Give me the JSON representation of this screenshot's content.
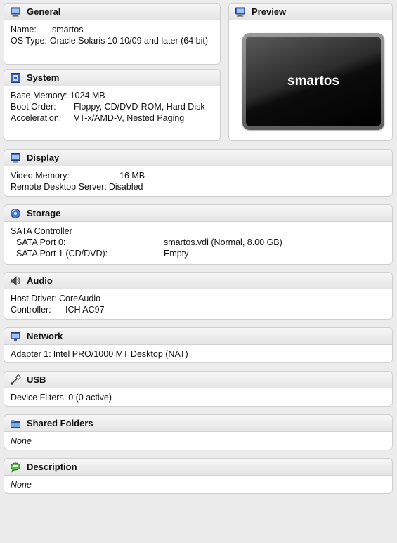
{
  "general": {
    "title": "General",
    "name_label": "Name:",
    "name_value": "smartos",
    "os_label": "OS Type:",
    "os_value": "Oracle Solaris 10 10/09 and later (64 bit)"
  },
  "preview": {
    "title": "Preview",
    "screen_text": "smartos"
  },
  "system": {
    "title": "System",
    "memory_label": "Base Memory:",
    "memory_value": "1024 MB",
    "boot_label": "Boot Order:",
    "boot_value": "Floppy, CD/DVD-ROM, Hard Disk",
    "accel_label": "Acceleration:",
    "accel_value": "VT-x/AMD-V, Nested Paging"
  },
  "display": {
    "title": "Display",
    "video_label": "Video Memory:",
    "video_value": "16 MB",
    "rds_label": "Remote Desktop Server:",
    "rds_value": "Disabled"
  },
  "storage": {
    "title": "Storage",
    "controller": "SATA Controller",
    "ports": [
      {
        "label": "SATA Port 0:",
        "value": "smartos.vdi (Normal, 8.00 GB)"
      },
      {
        "label": "SATA Port 1 (CD/DVD):",
        "value": "Empty"
      }
    ]
  },
  "audio": {
    "title": "Audio",
    "driver_label": "Host Driver:",
    "driver_value": "CoreAudio",
    "controller_label": "Controller:",
    "controller_value": "ICH AC97"
  },
  "network": {
    "title": "Network",
    "adapter_label": "Adapter 1:",
    "adapter_value": "Intel PRO/1000 MT Desktop (NAT)"
  },
  "usb": {
    "title": "USB",
    "filters_label": "Device Filters:",
    "filters_value": "0 (0 active)"
  },
  "shared_folders": {
    "title": "Shared Folders",
    "value": "None"
  },
  "description": {
    "title": "Description",
    "value": "None"
  },
  "icons": {
    "general": "monitor-icon",
    "preview": "monitor-icon",
    "system": "chip-icon",
    "display": "display-icon",
    "storage": "disk-icon",
    "audio": "speaker-icon",
    "network": "network-icon",
    "usb": "usb-icon",
    "shared_folders": "folder-icon",
    "description": "speech-bubble-icon"
  }
}
